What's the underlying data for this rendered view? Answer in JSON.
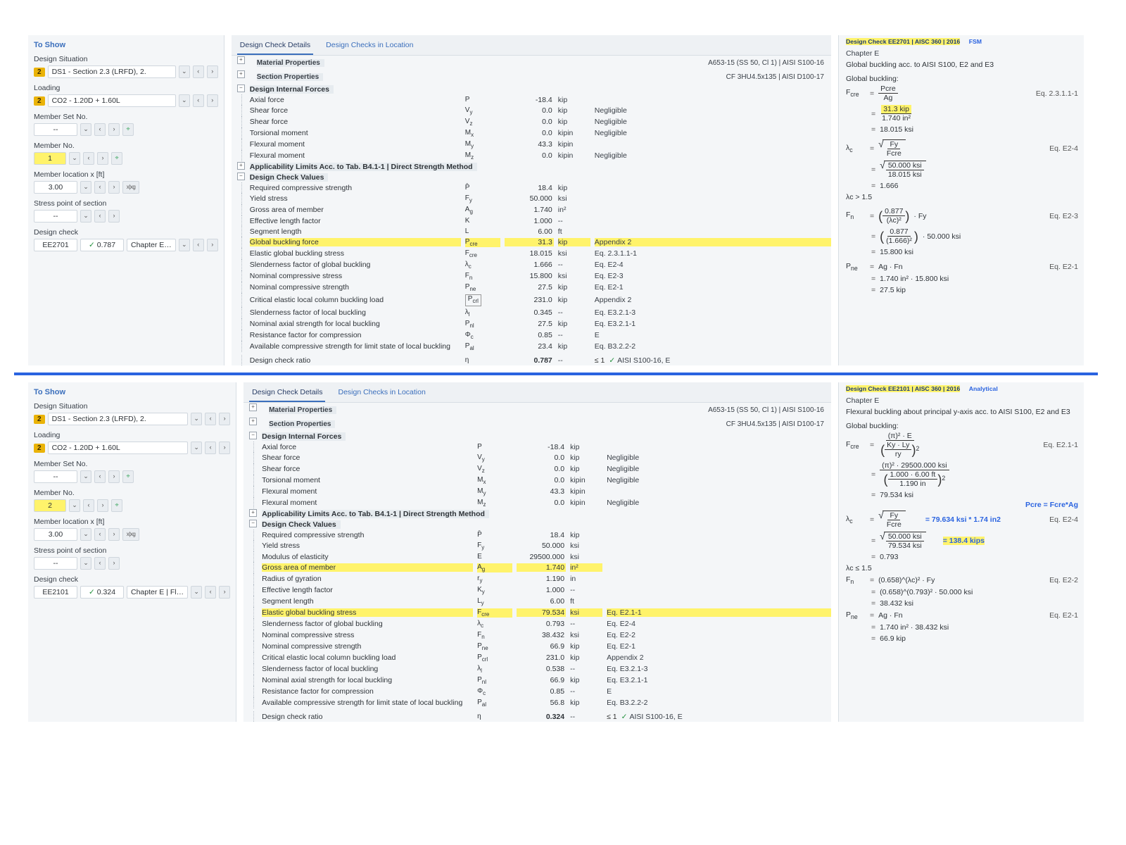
{
  "common": {
    "toShow": "To Show",
    "designSituationLbl": "Design Situation",
    "designSituationBadge": "2",
    "designSituationVal": "DS1 - Section 2.3 (LRFD), 2.",
    "loadingLbl": "Loading",
    "loadingBadge": "2",
    "loadingVal": "CO2 - 1.20D + 1.60L",
    "memberSetLbl": "Member Set No.",
    "memberSetVal": "--",
    "memberNoLbl": "Member No.",
    "memberLocLbl": "Member location x [ft]",
    "memberLocVal": "3.00",
    "stressPtLbl": "Stress point of section",
    "stressPtVal": "--",
    "designCheckLbl": "Design check",
    "tab_details": "Design Check Details",
    "tab_inloc": "Design Checks in Location",
    "grp_matprops": "Material Properties",
    "grp_sectprops": "Section Properties",
    "grp_dif": "Design Internal Forces",
    "grp_applim": "Applicability Limits Acc. to Tab. B4.1-1 | Direct Strength Method",
    "grp_dcv": "Design Check Values",
    "matLine": "A653-15 (SS 50, Cl 1) | AISI S100-16",
    "sectLine": "CF 3HU4.5x135 | AISI D100-17"
  },
  "forces_rows": {
    "axial": {
      "lbl": "Axial force",
      "sym": "P",
      "val": "-18.4",
      "unit": "kip",
      "ref": ""
    },
    "vy": {
      "lbl": "Shear force",
      "sym": "Vy",
      "sub": "y",
      "val": "0.0",
      "unit": "kip",
      "ref": "Negligible"
    },
    "vz": {
      "lbl": "Shear force",
      "sym": "Vz",
      "sub": "z",
      "val": "0.0",
      "unit": "kip",
      "ref": "Negligible"
    },
    "mx": {
      "lbl": "Torsional moment",
      "sym": "Mx",
      "sub": "x",
      "val": "0.0",
      "unit": "kipin",
      "ref": "Negligible"
    },
    "my": {
      "lbl": "Flexural moment",
      "sym": "My",
      "sub": "y",
      "val": "43.3",
      "unit": "kipin",
      "ref": ""
    },
    "mz": {
      "lbl": "Flexural moment",
      "sym": "Mz",
      "sub": "z",
      "val": "0.0",
      "unit": "kipin",
      "ref": "Negligible"
    }
  },
  "top": {
    "memberNoVal": "1",
    "memberNoHL": true,
    "dc_name": "EE2701",
    "dc_ratio": "0.787",
    "dc_chapter": "Chapter E…",
    "dcv": [
      {
        "lbl": "Required compressive strength",
        "sym": "P̄",
        "val": "18.4",
        "unit": "kip",
        "ref": ""
      },
      {
        "lbl": "Yield stress",
        "sym": "Fy",
        "sub": "y",
        "val": "50.000",
        "unit": "ksi",
        "ref": ""
      },
      {
        "lbl": "Gross area of member",
        "sym": "Ag",
        "sub": "g",
        "val": "1.740",
        "unit": "in²",
        "ref": ""
      },
      {
        "lbl": "Effective length factor",
        "sym": "K",
        "val": "1.000",
        "unit": "--",
        "ref": ""
      },
      {
        "lbl": "Segment length",
        "sym": "L",
        "val": "6.00",
        "unit": "ft",
        "ref": ""
      },
      {
        "lbl": "Global buckling force",
        "sym": "Pcre",
        "sub": "cre",
        "val": "31.3",
        "unit": "kip",
        "ref": "Appendix 2",
        "hl": true
      },
      {
        "lbl": "Elastic global buckling stress",
        "sym": "Fcre",
        "sub": "cre",
        "val": "18.015",
        "unit": "ksi",
        "ref": "Eq. 2.3.1.1-1"
      },
      {
        "lbl": "Slenderness factor of global buckling",
        "sym": "λc",
        "sub": "c",
        "val": "1.666",
        "unit": "--",
        "ref": "Eq. E2-4"
      },
      {
        "lbl": "Nominal compressive stress",
        "sym": "Fn",
        "sub": "n",
        "val": "15.800",
        "unit": "ksi",
        "ref": "Eq. E2-3"
      },
      {
        "lbl": "Nominal compressive strength",
        "sym": "Pne",
        "sub": "ne",
        "val": "27.5",
        "unit": "kip",
        "ref": "Eq. E2-1"
      },
      {
        "lbl": "Critical elastic local column buckling load",
        "sym": "Pcrl",
        "sub": "crl",
        "val": "231.0",
        "unit": "kip",
        "ref": "Appendix 2",
        "box": true
      },
      {
        "lbl": "Slenderness factor of local buckling",
        "sym": "λl",
        "sub": "l",
        "val": "0.345",
        "unit": "--",
        "ref": "Eq. E3.2.1-3"
      },
      {
        "lbl": "Nominal axial strength for local buckling",
        "sym": "Pnl",
        "sub": "nl",
        "val": "27.5",
        "unit": "kip",
        "ref": "Eq. E3.2.1-1"
      },
      {
        "lbl": "Resistance factor for compression",
        "sym": "Φc",
        "sub": "c",
        "val": "0.85",
        "unit": "--",
        "ref": "E"
      },
      {
        "lbl": "Available compressive strength for limit state of local buckling",
        "sym": "Pal",
        "sub": "al",
        "val": "23.4",
        "unit": "kip",
        "ref": "Eq. B3.2.2-2"
      }
    ],
    "eta": {
      "lbl": "Design check ratio",
      "sym": "η",
      "val": "0.787",
      "unit": "--",
      "ref": "AISI S100-16, E"
    },
    "rpanel": {
      "title": "Design Check EE2701",
      "std": " | AISC 360 | 2016",
      "mode": "FSM",
      "chap": "Chapter E",
      "desc": "Global buckling acc. to AISI S100, E2 and E3",
      "gbuck": "Global buckling:",
      "fcre_num": "Pcre",
      "fcre_den": "Ag",
      "ref1": "Eq. 2.3.1.1-1",
      "fcre_num2": "31.3 kip",
      "fcre_den2": "1.740 in²",
      "fcre_hl": true,
      "fcre_res": "18.015 ksi",
      "lam_num": "Fy",
      "lam_den": "Fcre",
      "ref2": "Eq. E2-4",
      "lam_num2": "50.000 ksi",
      "lam_den2": "18.015 ksi",
      "lam_res": "1.666",
      "lam_cond": "λc  >  1.5",
      "fn_lhs": "Fn",
      "fn_num": "0.877",
      "fn_den": "(λc)²",
      "fn_rhs": "· Fy",
      "ref3": "Eq. E2-3",
      "fn_num2": "0.877",
      "fn_den2": "(1.666)²",
      "fn_rhs2": "· 50.000 ksi",
      "fn_res": "15.800 ksi",
      "pne_lhs": "Pne",
      "pne_rhs": "Ag · Fn",
      "ref4": "Eq. E2-1",
      "pne_rhs2": "1.740 in² · 15.800 ksi",
      "pne_res": "27.5 kip"
    }
  },
  "bot": {
    "memberNoVal": "2",
    "memberNoHL": true,
    "dc_name": "EE2101",
    "dc_ratio": "0.324",
    "dc_chapter": "Chapter E | Fl…",
    "dcv": [
      {
        "lbl": "Required compressive strength",
        "sym": "P̄",
        "val": "18.4",
        "unit": "kip",
        "ref": ""
      },
      {
        "lbl": "Yield stress",
        "sym": "Fy",
        "sub": "y",
        "val": "50.000",
        "unit": "ksi",
        "ref": ""
      },
      {
        "lbl": "Modulus of elasticity",
        "sym": "E",
        "val": "29500.000",
        "unit": "ksi",
        "ref": ""
      },
      {
        "lbl": "Gross area of member",
        "sym": "Ag",
        "sub": "g",
        "val": "1.740",
        "unit": "in²",
        "ref": "",
        "hl": true
      },
      {
        "lbl": "Radius of gyration",
        "sym": "ry",
        "sub": "y",
        "val": "1.190",
        "unit": "in",
        "ref": ""
      },
      {
        "lbl": "Effective length factor",
        "sym": "Ky",
        "sub": "y",
        "val": "1.000",
        "unit": "--",
        "ref": ""
      },
      {
        "lbl": "Segment length",
        "sym": "Ly",
        "sub": "y",
        "val": "6.00",
        "unit": "ft",
        "ref": ""
      },
      {
        "lbl": "Elastic global buckling stress",
        "sym": "Fcre",
        "sub": "cre",
        "val": "79.534",
        "unit": "ksi",
        "ref": "Eq. E2.1-1",
        "hl": true
      },
      {
        "lbl": "Slenderness factor of global buckling",
        "sym": "λc",
        "sub": "c",
        "val": "0.793",
        "unit": "--",
        "ref": "Eq. E2-4"
      },
      {
        "lbl": "Nominal compressive stress",
        "sym": "Fn",
        "sub": "n",
        "val": "38.432",
        "unit": "ksi",
        "ref": "Eq. E2-2"
      },
      {
        "lbl": "Nominal compressive strength",
        "sym": "Pne",
        "sub": "ne",
        "val": "66.9",
        "unit": "kip",
        "ref": "Eq. E2-1"
      },
      {
        "lbl": "Critical elastic local column buckling load",
        "sym": "Pcrl",
        "sub": "crl",
        "val": "231.0",
        "unit": "kip",
        "ref": "Appendix 2"
      },
      {
        "lbl": "Slenderness factor of local buckling",
        "sym": "λl",
        "sub": "l",
        "val": "0.538",
        "unit": "--",
        "ref": "Eq. E3.2.1-3"
      },
      {
        "lbl": "Nominal axial strength for local buckling",
        "sym": "Pnl",
        "sub": "nl",
        "val": "66.9",
        "unit": "kip",
        "ref": "Eq. E3.2.1-1"
      },
      {
        "lbl": "Resistance factor for compression",
        "sym": "Φc",
        "sub": "c",
        "val": "0.85",
        "unit": "--",
        "ref": "E"
      },
      {
        "lbl": "Available compressive strength for limit state of local buckling",
        "sym": "Pal",
        "sub": "al",
        "val": "56.8",
        "unit": "kip",
        "ref": "Eq. B3.2.2-2"
      }
    ],
    "eta": {
      "lbl": "Design check ratio",
      "sym": "η",
      "val": "0.324",
      "unit": "--",
      "ref": "AISI S100-16, E"
    },
    "rpanel": {
      "title": "Design Check EE2101",
      "std": " | AISC 360 | 2016",
      "mode": "Analytical",
      "chap": "Chapter E",
      "desc": "Flexural buckling about principal y-axis acc. to AISI S100, E2 and E3",
      "gbuck": "Global buckling:",
      "fcre_lhs": "Fcre",
      "fcre_num": "(π)² · E",
      "fcre_den": "Ky · Ly",
      "fcre_den_sub": "ry",
      "ref1": "Eq. E2.1-1",
      "fcre_num2": "(π)² · 29500.000 ksi",
      "fcre_den2": "1.000 · 6.00 ft",
      "fcre_den2_sub": "1.190 in",
      "fcre_res": "79.534 ksi",
      "note1": "Pcre = Fcre*Ag",
      "note2": "= 79.634 ksi * 1.74 in2",
      "note3": "= 138.4 kips",
      "lam_num": "Fy",
      "lam_den": "Fcre",
      "ref2": "Eq. E2-4",
      "lam_num2": "50.000 ksi",
      "lam_den2": "79.534 ksi",
      "lam_res": "0.793",
      "lam_cond": "λc  ≤  1.5",
      "fn_lhs": "Fn",
      "fn_rhs": "(0.658)^(λc)² · Fy",
      "ref3": "Eq. E2-2",
      "fn_rhs2": "(0.658)^(0.793)² · 50.000 ksi",
      "fn_res": "38.432 ksi",
      "pne_lhs": "Pne",
      "pne_rhs": "Ag · Fn",
      "ref4": "Eq. E2-1",
      "pne_rhs2": "1.740 in² · 38.432 ksi",
      "pne_res": "66.9 kip"
    }
  }
}
